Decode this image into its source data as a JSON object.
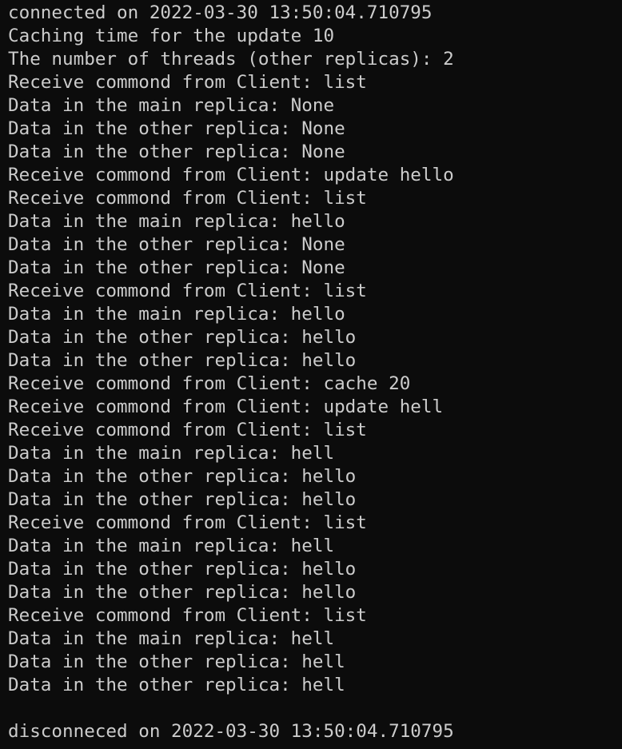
{
  "terminal": {
    "background": "#0c0c0c",
    "foreground": "#cccccc",
    "lines": [
      "connected on 2022-03-30 13:50:04.710795",
      "Caching time for the update 10",
      "The number of threads (other replicas): 2",
      "Receive commond from Client: list",
      "Data in the main replica: None",
      "Data in the other replica: None",
      "Data in the other replica: None",
      "Receive commond from Client: update hello",
      "Receive commond from Client: list",
      "Data in the main replica: hello",
      "Data in the other replica: None",
      "Data in the other replica: None",
      "Receive commond from Client: list",
      "Data in the main replica: hello",
      "Data in the other replica: hello",
      "Data in the other replica: hello",
      "Receive commond from Client: cache 20",
      "Receive commond from Client: update hell",
      "Receive commond from Client: list",
      "Data in the main replica: hell",
      "Data in the other replica: hello",
      "Data in the other replica: hello",
      "Receive commond from Client: list",
      "Data in the main replica: hell",
      "Data in the other replica: hello",
      "Data in the other replica: hello",
      "Receive commond from Client: list",
      "Data in the main replica: hell",
      "Data in the other replica: hell",
      "Data in the other replica: hell",
      "",
      "disconneced on 2022-03-30 13:50:04.710795"
    ]
  }
}
